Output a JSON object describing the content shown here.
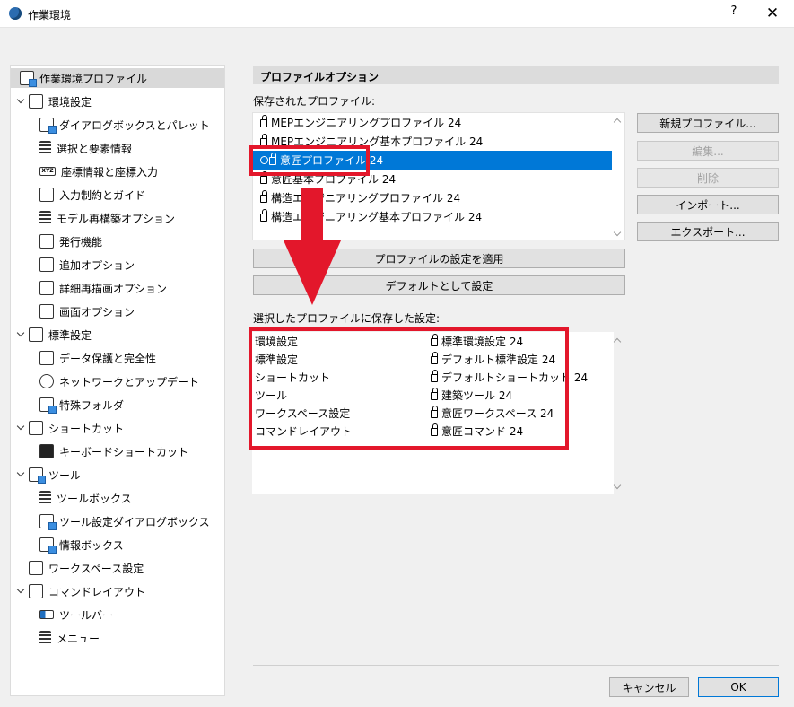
{
  "window": {
    "title": "作業環境",
    "help_label": "?",
    "close_label": "✕"
  },
  "tree": {
    "items": [
      {
        "label": "作業環境プロファイル"
      },
      {
        "label": "環境設定"
      },
      {
        "label": "ダイアログボックスとパレット"
      },
      {
        "label": "選択と要素情報"
      },
      {
        "label": "座標情報と座標入力"
      },
      {
        "label": "入力制約とガイド"
      },
      {
        "label": "モデル再構築オプション"
      },
      {
        "label": "発行機能"
      },
      {
        "label": "追加オプション"
      },
      {
        "label": "詳細再描画オプション"
      },
      {
        "label": "画面オプション"
      },
      {
        "label": "標準設定"
      },
      {
        "label": "データ保護と完全性"
      },
      {
        "label": "ネットワークとアップデート"
      },
      {
        "label": "特殊フォルダ"
      },
      {
        "label": "ショートカット"
      },
      {
        "label": "キーボードショートカット"
      },
      {
        "label": "ツール"
      },
      {
        "label": "ツールボックス"
      },
      {
        "label": "ツール設定ダイアログボックス"
      },
      {
        "label": "情報ボックス"
      },
      {
        "label": "ワークスペース設定"
      },
      {
        "label": "コマンドレイアウト"
      },
      {
        "label": "ツールバー"
      },
      {
        "label": "メニュー"
      }
    ]
  },
  "profile": {
    "header": "プロファイルオプション",
    "saved_label": "保存されたプロファイル:",
    "profiles": [
      "MEPエンジニアリングプロファイル 24",
      "MEPエンジニアリング基本プロファイル 24",
      "意匠プロファイル 24",
      "意匠基本プロファイル 24",
      "構造エンジニアリングプロファイル 24",
      "構造エンジニアリング基本プロファイル 24"
    ],
    "selected_profile": "意匠プロファイル 24",
    "buttons": {
      "new": "新規プロファイル...",
      "edit": "編集...",
      "delete": "削除",
      "import": "インポート...",
      "export": "エクスポート..."
    },
    "apply_button": "プロファイルの設定を適用",
    "default_button": "デフォルトとして設定",
    "saved_settings_label": "選択したプロファイルに保存した設定:",
    "settings": [
      {
        "name": "環境設定",
        "value": "標準環境設定 24"
      },
      {
        "name": "標準設定",
        "value": "デフォルト標準設定 24"
      },
      {
        "name": "ショートカット",
        "value": "デフォルトショートカット 24"
      },
      {
        "name": "ツール",
        "value": "建築ツール 24"
      },
      {
        "name": "ワークスペース設定",
        "value": "意匠ワークスペース 24"
      },
      {
        "name": "コマンドレイアウト",
        "value": "意匠コマンド 24"
      }
    ]
  },
  "footer": {
    "cancel": "キャンセル",
    "ok": "OK"
  },
  "colors": {
    "selection": "#0078d7",
    "annotation_red": "#e3172b"
  }
}
